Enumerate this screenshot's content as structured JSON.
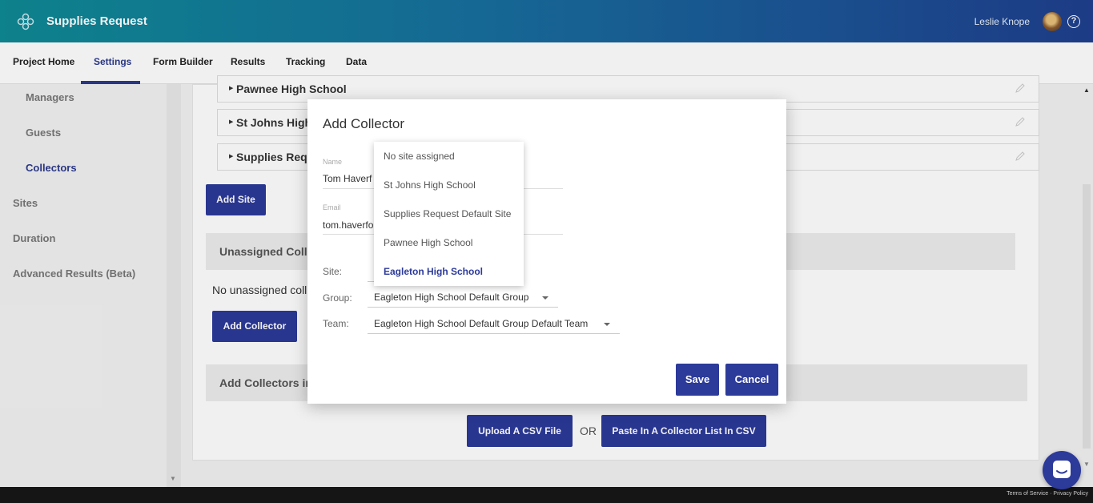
{
  "header": {
    "app_title": "Supplies Request",
    "user_name": "Leslie Knope",
    "help_glyph": "?"
  },
  "nav": {
    "tabs": [
      "Project Home",
      "Settings",
      "Form Builder",
      "Results",
      "Tracking",
      "Data"
    ],
    "active": "Settings"
  },
  "sidebar": {
    "items": [
      "Managers",
      "Guests",
      "Collectors",
      "Sites",
      "Duration",
      "Advanced Results (Beta)"
    ],
    "active": "Collectors"
  },
  "main": {
    "sites": [
      "Pawnee High School",
      "St Johns High S",
      "Supplies Reque"
    ],
    "add_site_label": "Add Site",
    "unassigned_heading": "Unassigned Colle",
    "no_unassigned_text": "No unassigned coll",
    "add_collector_label": "Add Collector",
    "bulk_heading": "Add Collectors in",
    "upload_csv_label": "Upload A CSV File",
    "or_text": "OR",
    "paste_csv_label": "Paste In A Collector List In CSV"
  },
  "modal": {
    "title": "Add Collector",
    "name_label": "Name",
    "name_value": "Tom Haverf",
    "email_label": "Email",
    "email_value": "tom.haverfo",
    "site_label": "Site:",
    "group_label": "Group:",
    "group_value": "Eagleton High School Default Group",
    "team_label": "Team:",
    "team_value": "Eagleton High School Default Group Default Team",
    "save_label": "Save",
    "cancel_label": "Cancel"
  },
  "site_dropdown": {
    "options": [
      "No site assigned",
      "St Johns High School",
      "Supplies Request Default Site",
      "Pawnee High School",
      "Eagleton High School"
    ],
    "selected": "Eagleton High School"
  },
  "footer": {
    "links": "Terms of Service · Privacy Policy"
  },
  "colors": {
    "accent": "#2c3a9a",
    "header_start": "#0e8a95",
    "header_end": "#1f3f8f"
  }
}
